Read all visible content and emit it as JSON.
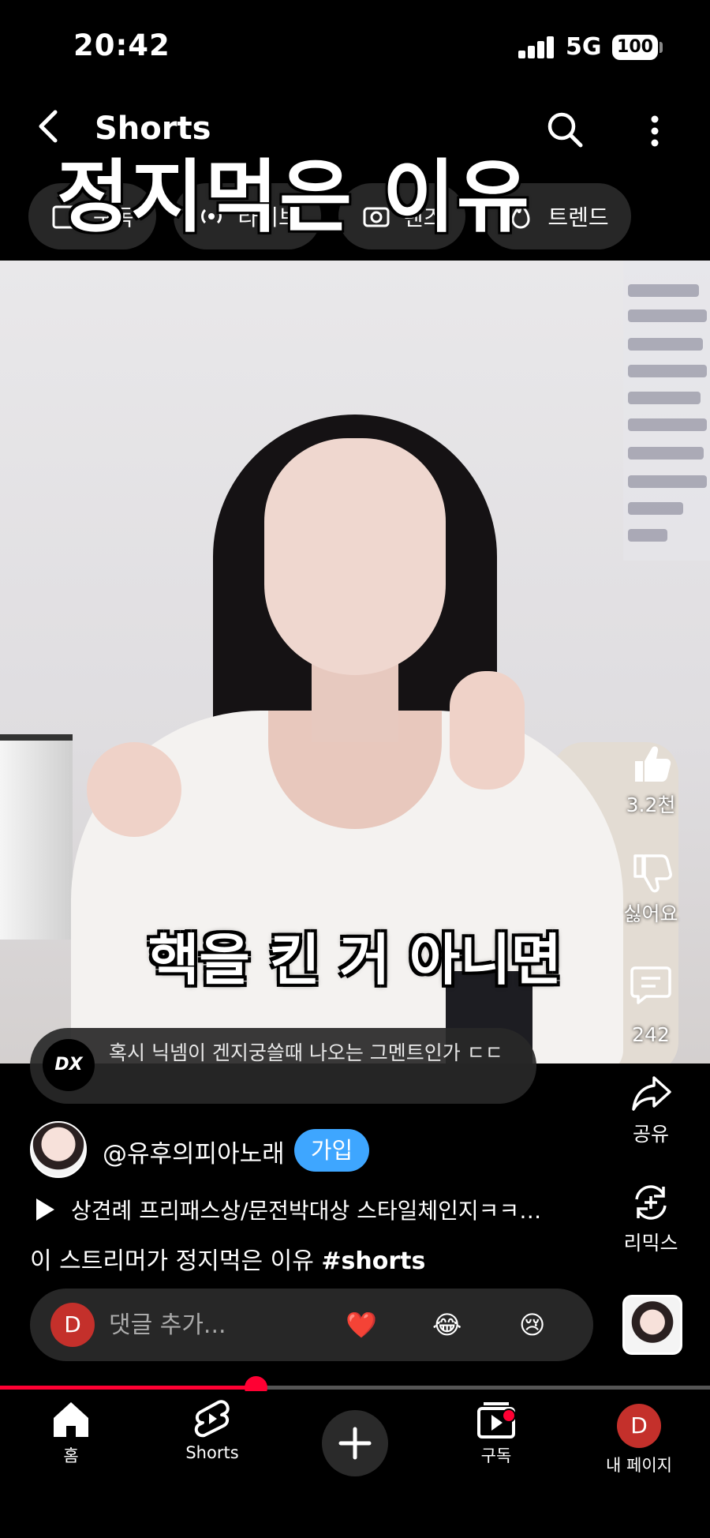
{
  "status_bar": {
    "time": "20:42",
    "network": "5G",
    "battery": "100"
  },
  "header": {
    "title": "Shorts",
    "chips": [
      {
        "label": "구독",
        "icon": "subscriptions-icon"
      },
      {
        "label": "라이브",
        "icon": "live-icon"
      },
      {
        "label": "렌즈",
        "icon": "lens-icon"
      },
      {
        "label": "트렌드",
        "icon": "trending-icon"
      }
    ]
  },
  "video": {
    "caption_top": "정지먹은 이유",
    "subtitle": "핵을 킨 거 아니면"
  },
  "actions": {
    "like_count": "3.2천",
    "dislike_label": "싫어요",
    "comment_count": "242",
    "share_label": "공유",
    "remix_label": "리믹스"
  },
  "comment_preview": {
    "logo_text": "DX",
    "text": "혹시 닉넴이 겐지궁쓸때 나오는 그멘트인가 ㄷㄷ"
  },
  "channel": {
    "name": "@유후의피아노래",
    "join_label": "가입"
  },
  "music": {
    "title": "상견례 프리패스상/문전박대상 스타일체인지ㅋㅋ…"
  },
  "video_title": {
    "text": "이 스트리머가 정지먹은 이유 ",
    "hashtag": "#shorts"
  },
  "comment_bar": {
    "user_initial": "D",
    "placeholder": "댓글 추가...",
    "emojis": [
      "❤️",
      "😂",
      "😢"
    ]
  },
  "progress": {
    "played_fraction": 0.36
  },
  "nav": {
    "home_label": "홈",
    "shorts_label": "Shorts",
    "subscriptions_label": "구독",
    "profile_label": "내 페이지",
    "profile_initial": "D"
  },
  "colors": {
    "accent": "#ff0033",
    "join_button": "#3ea6ff",
    "user_avatar": "#c4302b",
    "pill_background": "#272727"
  }
}
